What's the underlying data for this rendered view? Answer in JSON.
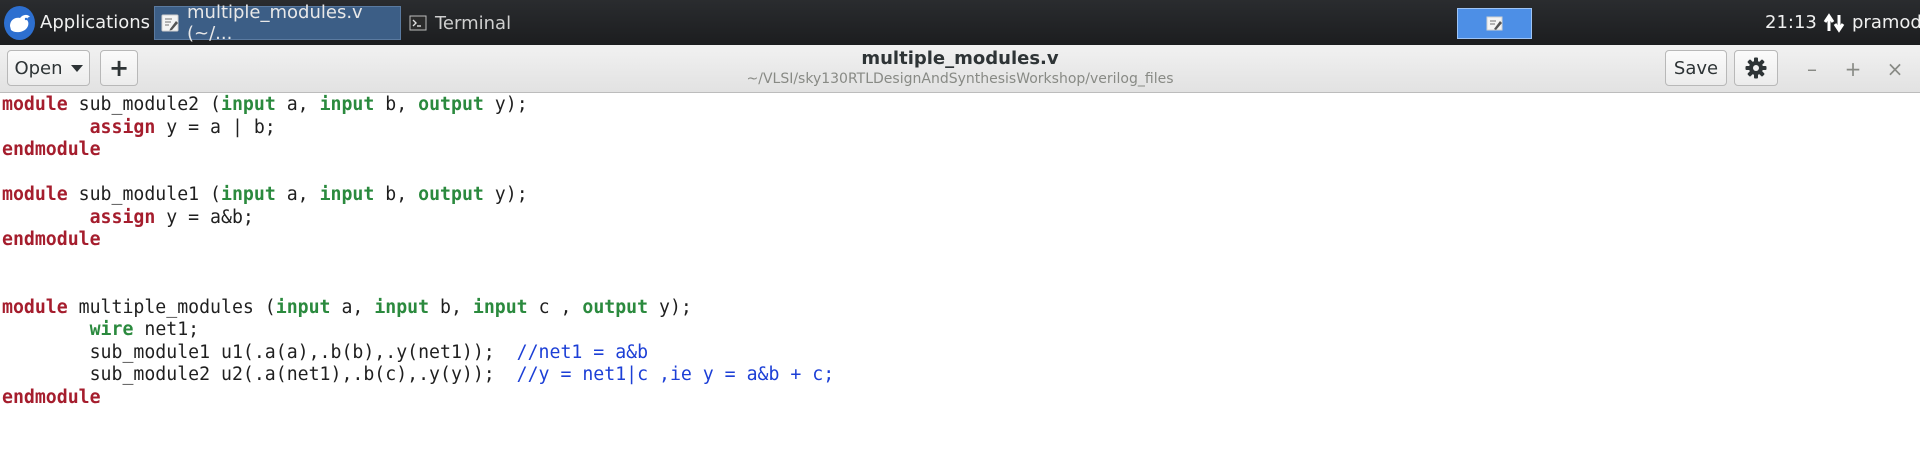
{
  "panel": {
    "applications_label": "Applications",
    "tasks": [
      {
        "label": "multiple_modules.v (~/...",
        "active": true
      },
      {
        "label": "Terminal",
        "active": false
      }
    ],
    "clock": "21:13",
    "user": "pramod"
  },
  "headerbar": {
    "open_label": "Open",
    "new_label": "+",
    "title": "multiple_modules.v",
    "subtitle": "~/VLSI/sky130RTLDesignAndSynthesisWorkshop/verilog_files",
    "save_label": "Save",
    "minimize_glyph": "–",
    "maximize_glyph": "+",
    "close_glyph": "×"
  },
  "colors": {
    "keyword_red": "#a51d2d",
    "keyword_green": "#2b8a3e",
    "comment_blue": "#1c3fd6",
    "panel_bg": "#1c1d1f",
    "active_task": "#3c5e86",
    "workspace": "#4d8fe6"
  },
  "editor": {
    "lines": [
      [
        {
          "t": "module",
          "c": "kw-red"
        },
        {
          "t": " sub_module2 ("
        },
        {
          "t": "input",
          "c": "kw-green"
        },
        {
          "t": " a, "
        },
        {
          "t": "input",
          "c": "kw-green"
        },
        {
          "t": " b, "
        },
        {
          "t": "output",
          "c": "kw-green"
        },
        {
          "t": " y);"
        }
      ],
      [
        {
          "t": "        "
        },
        {
          "t": "assign",
          "c": "kw-red"
        },
        {
          "t": " y = a | b;"
        }
      ],
      [
        {
          "t": "endmodule",
          "c": "kw-red"
        }
      ],
      [],
      [
        {
          "t": "module",
          "c": "kw-red"
        },
        {
          "t": " sub_module1 ("
        },
        {
          "t": "input",
          "c": "kw-green"
        },
        {
          "t": " a, "
        },
        {
          "t": "input",
          "c": "kw-green"
        },
        {
          "t": " b, "
        },
        {
          "t": "output",
          "c": "kw-green"
        },
        {
          "t": " y);"
        }
      ],
      [
        {
          "t": "        "
        },
        {
          "t": "assign",
          "c": "kw-red"
        },
        {
          "t": " y = a&b;"
        }
      ],
      [
        {
          "t": "endmodule",
          "c": "kw-red"
        }
      ],
      [],
      [],
      [
        {
          "t": "module",
          "c": "kw-red"
        },
        {
          "t": " multiple_modules ("
        },
        {
          "t": "input",
          "c": "kw-green"
        },
        {
          "t": " a, "
        },
        {
          "t": "input",
          "c": "kw-green"
        },
        {
          "t": " b, "
        },
        {
          "t": "input",
          "c": "kw-green"
        },
        {
          "t": " c , "
        },
        {
          "t": "output",
          "c": "kw-green"
        },
        {
          "t": " y);"
        }
      ],
      [
        {
          "t": "        "
        },
        {
          "t": "wire",
          "c": "kw-green"
        },
        {
          "t": " net1;"
        }
      ],
      [
        {
          "t": "        sub_module1 u1(.a(a),.b(b),.y(net1));  "
        },
        {
          "t": "//net1 = a&b",
          "c": "cm"
        }
      ],
      [
        {
          "t": "        sub_module2 u2(.a(net1),.b(c),.y(y));  "
        },
        {
          "t": "//y = net1|c ,ie y = a&b + c;",
          "c": "cm"
        }
      ],
      [
        {
          "t": "endmodule",
          "c": "kw-red"
        }
      ]
    ]
  }
}
